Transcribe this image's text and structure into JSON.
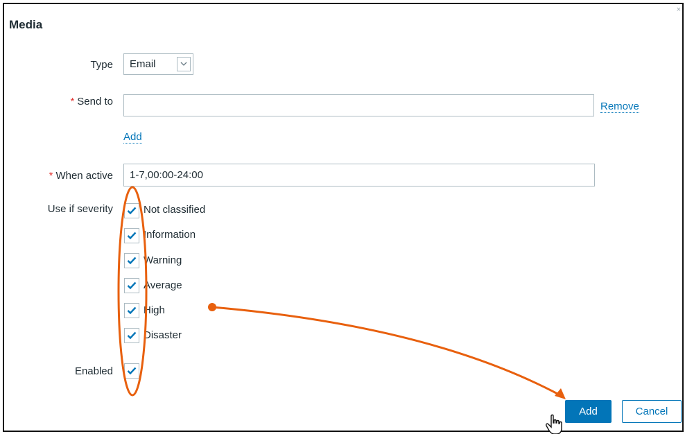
{
  "dialog": {
    "title": "Media",
    "close_symbol": "×"
  },
  "form": {
    "type": {
      "label": "Type",
      "value": "Email"
    },
    "send_to": {
      "label": "Send to",
      "value": "",
      "remove_link": "Remove",
      "add_link": "Add",
      "required_mark": "*"
    },
    "when_active": {
      "label": "When active",
      "value": "1-7,00:00-24:00",
      "required_mark": "*"
    },
    "severity": {
      "label": "Use if severity",
      "options": [
        {
          "label": "Not classified",
          "checked": true
        },
        {
          "label": "Information",
          "checked": true
        },
        {
          "label": "Warning",
          "checked": true
        },
        {
          "label": "Average",
          "checked": true
        },
        {
          "label": "High",
          "checked": true
        },
        {
          "label": "Disaster",
          "checked": true
        }
      ]
    },
    "enabled": {
      "label": "Enabled",
      "checked": true
    }
  },
  "buttons": {
    "add": "Add",
    "cancel": "Cancel"
  },
  "annotation": {
    "color": "#e8600e",
    "icon": "hand-pointer-icon"
  },
  "colors": {
    "link": "#0275b8",
    "required": "#e33734",
    "border": "#acbbc2"
  }
}
